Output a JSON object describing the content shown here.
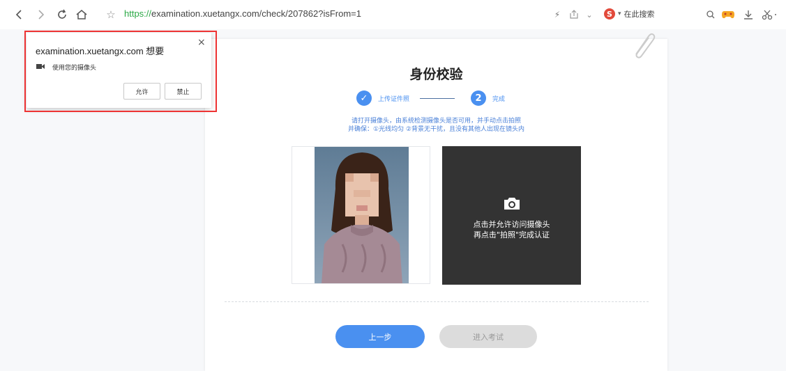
{
  "browser": {
    "url_scheme": "https://",
    "url_rest": "examination.xuetangx.com/check/207862?isFrom=1",
    "search_engine_label": "在此搜索",
    "accent_color": "#2aa845"
  },
  "permission_popup": {
    "title": "examination.xuetangx.com 想要",
    "close": "×",
    "permission": "使用您的摄像头",
    "allow_label": "允许",
    "block_label": "禁止"
  },
  "page": {
    "title": "身份校验",
    "steps": [
      {
        "number": "✓",
        "label": "上传证件照"
      },
      {
        "number": "2",
        "label": "完成"
      }
    ],
    "instructions": [
      "请打开摄像头，由系统检测摄像头是否可用，并手动点击拍照",
      "并确保：①光线均匀 ②背景无干扰，且没有其他人出现在镜头内"
    ],
    "camera_text": [
      "点击并允许访问摄像头",
      "再点击\"拍照\"完成认证"
    ],
    "prev_button": "上一步",
    "next_button": "进入考试",
    "accent_color": "#4a90f0"
  }
}
